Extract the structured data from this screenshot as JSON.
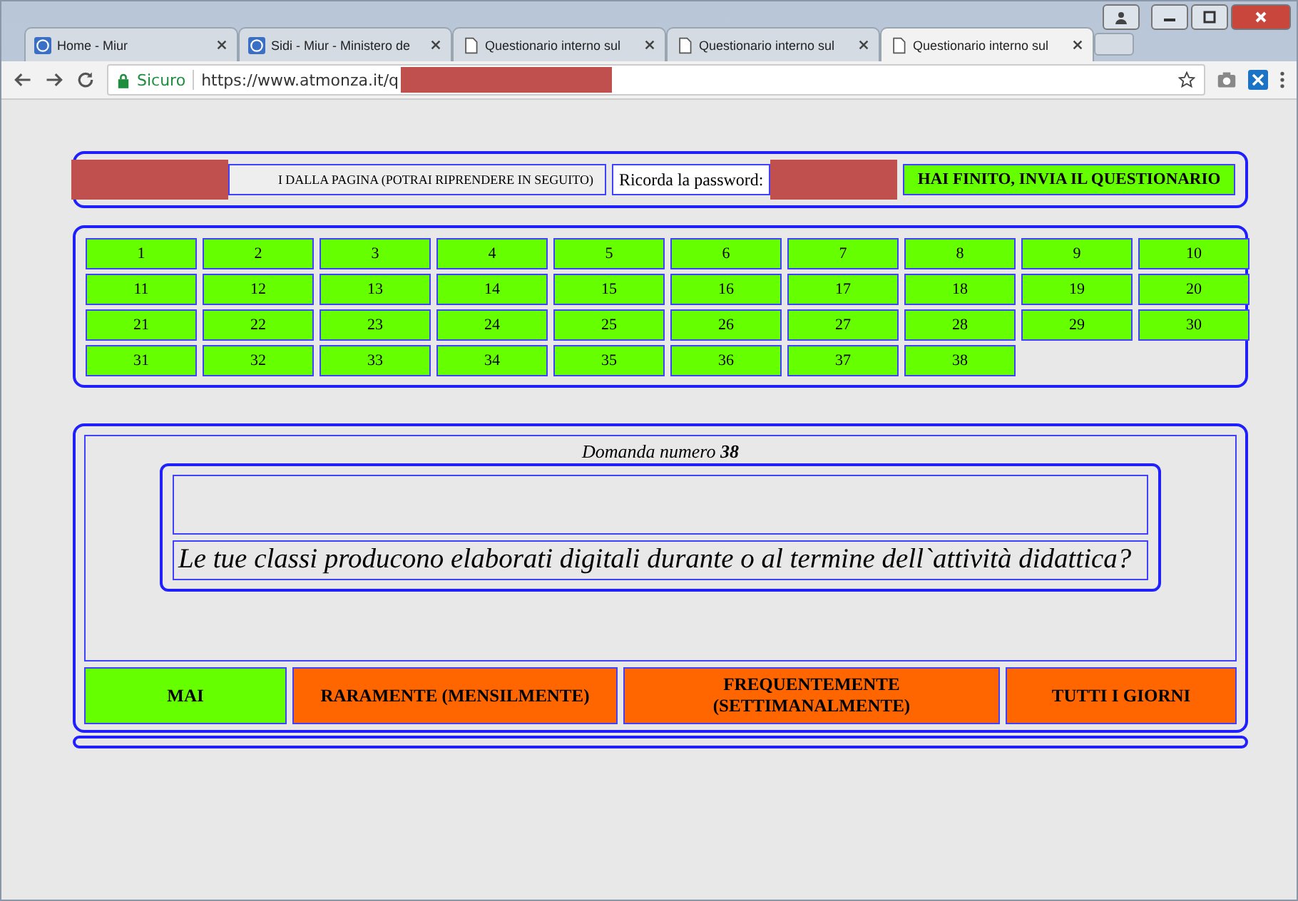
{
  "tabs": [
    {
      "label": "Home - Miur",
      "kind": "site",
      "selected": false
    },
    {
      "label": "Sidi - Miur - Ministero de",
      "kind": "site",
      "selected": false
    },
    {
      "label": "Questionario interno sul",
      "kind": "page",
      "selected": false
    },
    {
      "label": "Questionario interno sul",
      "kind": "page",
      "selected": false
    },
    {
      "label": "Questionario interno sul",
      "kind": "page",
      "selected": true
    }
  ],
  "address_bar": {
    "security": "Sicuro",
    "url": "https://www.atmonza.it/q"
  },
  "toolbar": {
    "exit_button": "I DALLA PAGINA (POTRAI RIPRENDERE IN SEGUITO)",
    "password_label": "Ricorda la password:",
    "submit_button": "HAI FINITO, INVIA IL QUESTIONARIO"
  },
  "question_numbers": [
    {
      "label": "1",
      "answered": true
    },
    {
      "label": "2",
      "answered": true
    },
    {
      "label": "3",
      "answered": true
    },
    {
      "label": "4",
      "answered": true
    },
    {
      "label": "5",
      "answered": true
    },
    {
      "label": "6",
      "answered": true
    },
    {
      "label": "7",
      "answered": true
    },
    {
      "label": "8",
      "answered": true
    },
    {
      "label": "9",
      "answered": true
    },
    {
      "label": "10",
      "answered": true
    },
    {
      "label": "11",
      "answered": true
    },
    {
      "label": "12",
      "answered": true
    },
    {
      "label": "13",
      "answered": true
    },
    {
      "label": "14",
      "answered": true
    },
    {
      "label": "15",
      "answered": true
    },
    {
      "label": "16",
      "answered": true
    },
    {
      "label": "17",
      "answered": true
    },
    {
      "label": "18",
      "answered": true
    },
    {
      "label": "19",
      "answered": true
    },
    {
      "label": "20",
      "answered": true
    },
    {
      "label": "21",
      "answered": true
    },
    {
      "label": "22",
      "answered": true
    },
    {
      "label": "23",
      "answered": true
    },
    {
      "label": "24",
      "answered": true
    },
    {
      "label": "25",
      "answered": true
    },
    {
      "label": "26",
      "answered": true
    },
    {
      "label": "27",
      "answered": true
    },
    {
      "label": "28",
      "answered": true
    },
    {
      "label": "29",
      "answered": true
    },
    {
      "label": "30",
      "answered": true
    },
    {
      "label": "31",
      "answered": true
    },
    {
      "label": "32",
      "answered": true
    },
    {
      "label": "33",
      "answered": true
    },
    {
      "label": "34",
      "answered": true
    },
    {
      "label": "35",
      "answered": true
    },
    {
      "label": "36",
      "answered": true
    },
    {
      "label": "37",
      "answered": true
    },
    {
      "label": "38",
      "answered": true
    }
  ],
  "question": {
    "heading": "Domanda numero **38**",
    "text": "Le tue classi producono elaborati digitali durante o al termine dell`attività didattica?"
  },
  "answers": [
    {
      "label": "MAI",
      "selected": true
    },
    {
      "label": "RARAMENTE (MENSILMENTE)",
      "selected": false
    },
    {
      "label": "FREQUENTEMENTE (SETTIMANALMENTE)",
      "selected": false
    },
    {
      "label": "TUTTI I GIORNI",
      "selected": false
    }
  ]
}
